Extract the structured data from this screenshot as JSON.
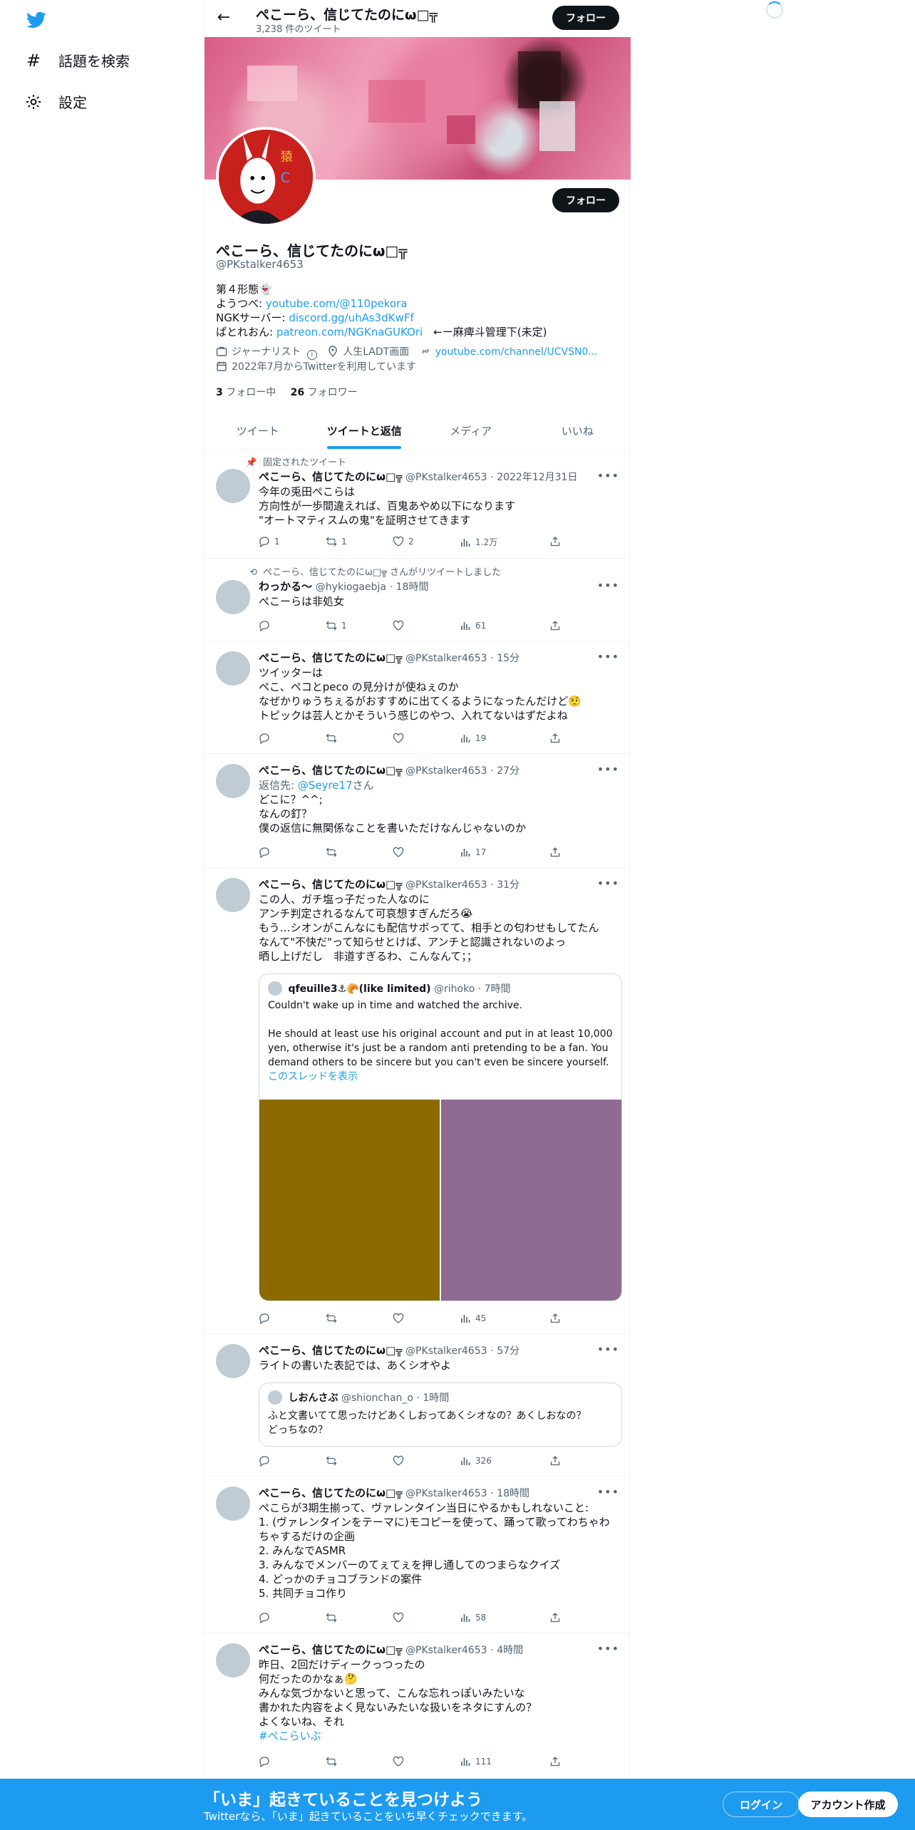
{
  "nav": {
    "explore": "話題を検索",
    "settings": "設定"
  },
  "header": {
    "name": "ぺこーら、信じてたのにω□╦",
    "tweet_count": "3,238 件のツイート",
    "follow": "フォロー"
  },
  "profile": {
    "name": "ぺこーら、信じてたのにω□╦",
    "handle": "@PKstalker4653",
    "follow": "フォロー",
    "bio": {
      "line1": "第４形態👻",
      "youtube_label": "ようつべ: ",
      "youtube_link": "youtube.com/@110pekora",
      "ngk_label": "NGKサーバー: ",
      "ngk_link": "discord.gg/uhAs3dKwFf",
      "patreon_label": "ぱとれおん: ",
      "patreon_link": "patreon.com/NGKnaGUKOri",
      "patreon_note": "　←ー麻痺斗管理下(未定)"
    },
    "job": "ジャーナリスト",
    "location": "人生LADT画面",
    "url": "youtube.com/channel/UCVSN0...",
    "joined": "2022年7月からTwitterを利用しています",
    "following_count": "3",
    "following_label": "フォロー中",
    "followers_count": "26",
    "followers_label": "フォロワー"
  },
  "tabs": [
    {
      "label": "ツイート"
    },
    {
      "label": "ツイートと返信"
    },
    {
      "label": "メディア"
    },
    {
      "label": "いいね"
    }
  ],
  "tweets": [
    {
      "social": "固定されたツイート",
      "name": "ぺこーら、信じてたのにω□╦",
      "handle": "@PKstalker4653",
      "time": "· 2022年12月31日",
      "lines": [
        "今年の兎田ぺこらは",
        "方向性が一歩間違えれば、百鬼あやめ以下になります",
        "\"オートマティスムの鬼\"を証明させてきます"
      ],
      "reply": "1",
      "retweet": "1",
      "like": "2",
      "views": "1.2万"
    },
    {
      "social": "ぺこーら、信じてたのにω□╦ さんがリツイートしました",
      "name": "わっかる～",
      "handle": "@hykiogaebja",
      "time": "· 18時間",
      "lines": [
        "ぺこーらは非処女"
      ],
      "reply": "",
      "retweet": "1",
      "like": "",
      "views": "61"
    },
    {
      "name": "ぺこーら、信じてたのにω□╦",
      "handle": "@PKstalker4653",
      "time": "· 15分",
      "lines": [
        "ツイッターは",
        "ペこ、ペコとpeco の見分けが使ねぇのか",
        "なぜかりゅうちぇるがおすすめに出てくるようになったんだけど🤨",
        "トピックは芸人とかそういう感じのやつ、入れてないはずだよね"
      ],
      "reply": "",
      "retweet": "",
      "like": "",
      "views": "19"
    },
    {
      "name": "ぺこーら、信じてたのにω□╦",
      "handle": "@PKstalker4653",
      "time": "· 27分",
      "reply_to_label": "返信先: ",
      "reply_to_user": "@Seyre17",
      "reply_to_suffix": "さん",
      "lines": [
        "どこに？^^;",
        "なんの釘？",
        "僕の返信に無関係なことを書いただけなんじゃないのか"
      ],
      "reply": "",
      "retweet": "",
      "like": "",
      "views": "17"
    },
    {
      "name": "ぺこーら、信じてたのにω□╦",
      "handle": "@PKstalker4653",
      "time": "· 31分",
      "lines": [
        "この人、ガチ塩っ子だった人なのに",
        "アンチ判定されるなんて可哀想すぎんだろ😭",
        "もう…シオンがこんなにも配信サボってて、相手との匂わせもしてたん",
        "なんて\"不快だ\"って知らせとけば、アンチと認識されないのよっ",
        "晒し上げだし　非道すぎるわ、こんなんて；；"
      ],
      "quote": {
        "name": "qfeuille3⚓🥐(like limited)",
        "handle": "@rihoko",
        "time": "· 7時間",
        "lines": [
          "Couldn't wake up in time and watched the archive.",
          "",
          "He should at least use his original account and put in at least 10,000",
          "yen, otherwise it's just be a random anti pretending to be a fan.  You",
          "demand others to be sincere but you can't even be sincere yourself."
        ],
        "thread_link": "このスレッドを表示",
        "image_colors": [
          "#8c6a00",
          "#8f6a93"
        ]
      },
      "reply": "",
      "retweet": "",
      "like": "",
      "views": "45"
    },
    {
      "name": "ぺこーら、信じてたのにω□╦",
      "handle": "@PKstalker4653",
      "time": "· 57分",
      "lines": [
        "ライトの書いた表記では、あくシオやよ"
      ],
      "quote": {
        "name": "しおんさぶ",
        "handle": "@shionchan_o",
        "time": "· 1時間",
        "lines": [
          "ふと文書いてて思ったけどあくしおってあくシオなの？あくしおなの？",
          "どっちなの？"
        ]
      },
      "reply": "",
      "retweet": "",
      "like": "",
      "views": "326"
    },
    {
      "name": "ぺこーら、信じてたのにω□╦",
      "handle": "@PKstalker4653",
      "time": "· 18時間",
      "lines": [
        "ぺこらが3期生揃って、ヴァレンタイン当日にやるかもしれないこと:",
        "1. (ヴァレンタインをテーマに)モコピーを使って、踊って歌ってわちゃわ",
        "ちゃするだけの企画",
        "2. みんなでASMR",
        "3. みんなでメンバーのてぇてぇを押し通してのつまらなクイズ",
        "4. どっかのチョコブランドの案件",
        "5. 共同チョコ作り"
      ],
      "reply": "",
      "retweet": "",
      "like": "",
      "views": "58"
    },
    {
      "name": "ぺこーら、信じてたのにω□╦",
      "handle": "@PKstalker4653",
      "time": "· 4時間",
      "lines": [
        "昨日、2回だけディークっつったの",
        "何だったのかなぁ🤔",
        "みんな気づかないと思って、こんな忘れっぽいみたいな",
        "書かれた内容をよく見ないみたいな扱いをネタにすんの？",
        "よくないね、それ"
      ],
      "hashtag": "#ぺこらいぶ",
      "reply": "",
      "retweet": "",
      "like": "",
      "views": "111"
    }
  ],
  "bottom_bar": {
    "title": "「いま」起きていることを見つけよう",
    "subtitle": "Twitterなら、「いま」起きていることをいち早くチェックできます。",
    "login": "ログイン",
    "signup": "アカウント作成"
  },
  "colors": {
    "accent": "#1d9bf0",
    "text": "#0f1419",
    "muted": "#536471"
  }
}
